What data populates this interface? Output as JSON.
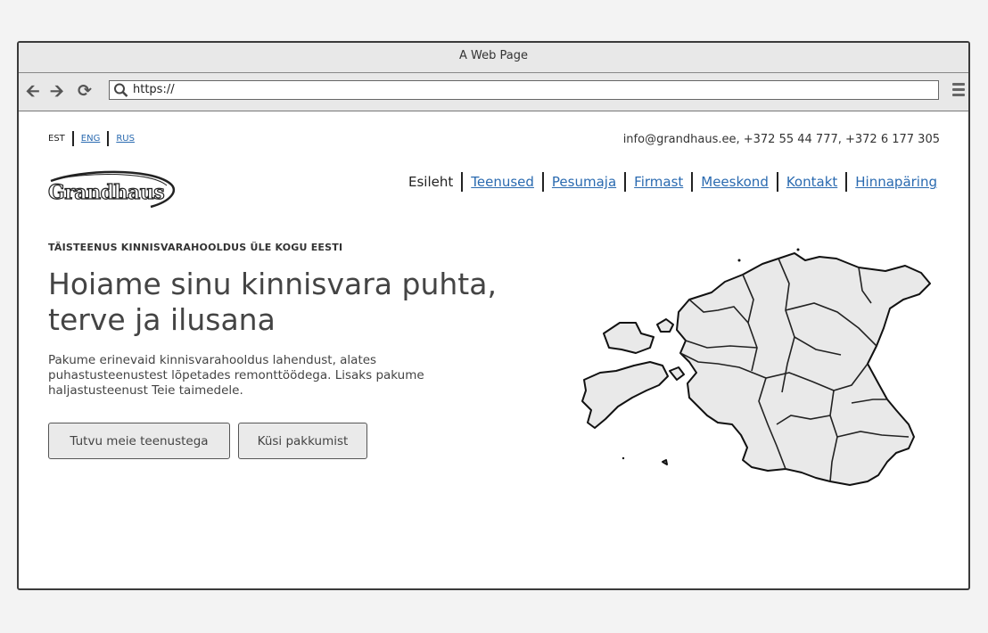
{
  "window": {
    "title": "A Web Page"
  },
  "browser": {
    "url": "https://",
    "icons": [
      "back-arrow-icon",
      "forward-arrow-icon",
      "reload-icon",
      "search-icon",
      "hamburger-menu-icon"
    ]
  },
  "languages": [
    {
      "label": "EST",
      "active": true
    },
    {
      "label": "ENG",
      "active": false
    },
    {
      "label": "RUS",
      "active": false
    }
  ],
  "contact": {
    "text": "info@grandhaus.ee, +372 55 44 777, +372 6 177 305"
  },
  "logo": {
    "text": "Grandhaus"
  },
  "nav": [
    {
      "label": "Esileht",
      "active": true
    },
    {
      "label": "Teenused"
    },
    {
      "label": "Pesumaja"
    },
    {
      "label": "Firmast"
    },
    {
      "label": "Meeskond"
    },
    {
      "label": "Kontakt"
    },
    {
      "label": "Hinnapäring"
    }
  ],
  "hero": {
    "kicker": "TÄISTEENUS KINNISVARAHOOLDUS ÜLE KOGU EESTI",
    "headline": "Hoiame sinu kinnisvara puhta, terve ja ilusana",
    "description": "Pakume erinevaid kinnisvarahooldus lahendust, alates puhastusteenustest lõpetades remonttöödega. Lisaks pakume haljastusteenust Teie taimedele.",
    "primary_button": "Tutvu meie teenustega",
    "secondary_button": "Küsi pakkumist"
  },
  "colors": {
    "link": "#2a6ab0",
    "map_fill": "#e9e9e9",
    "border": "#3a3a3a"
  }
}
